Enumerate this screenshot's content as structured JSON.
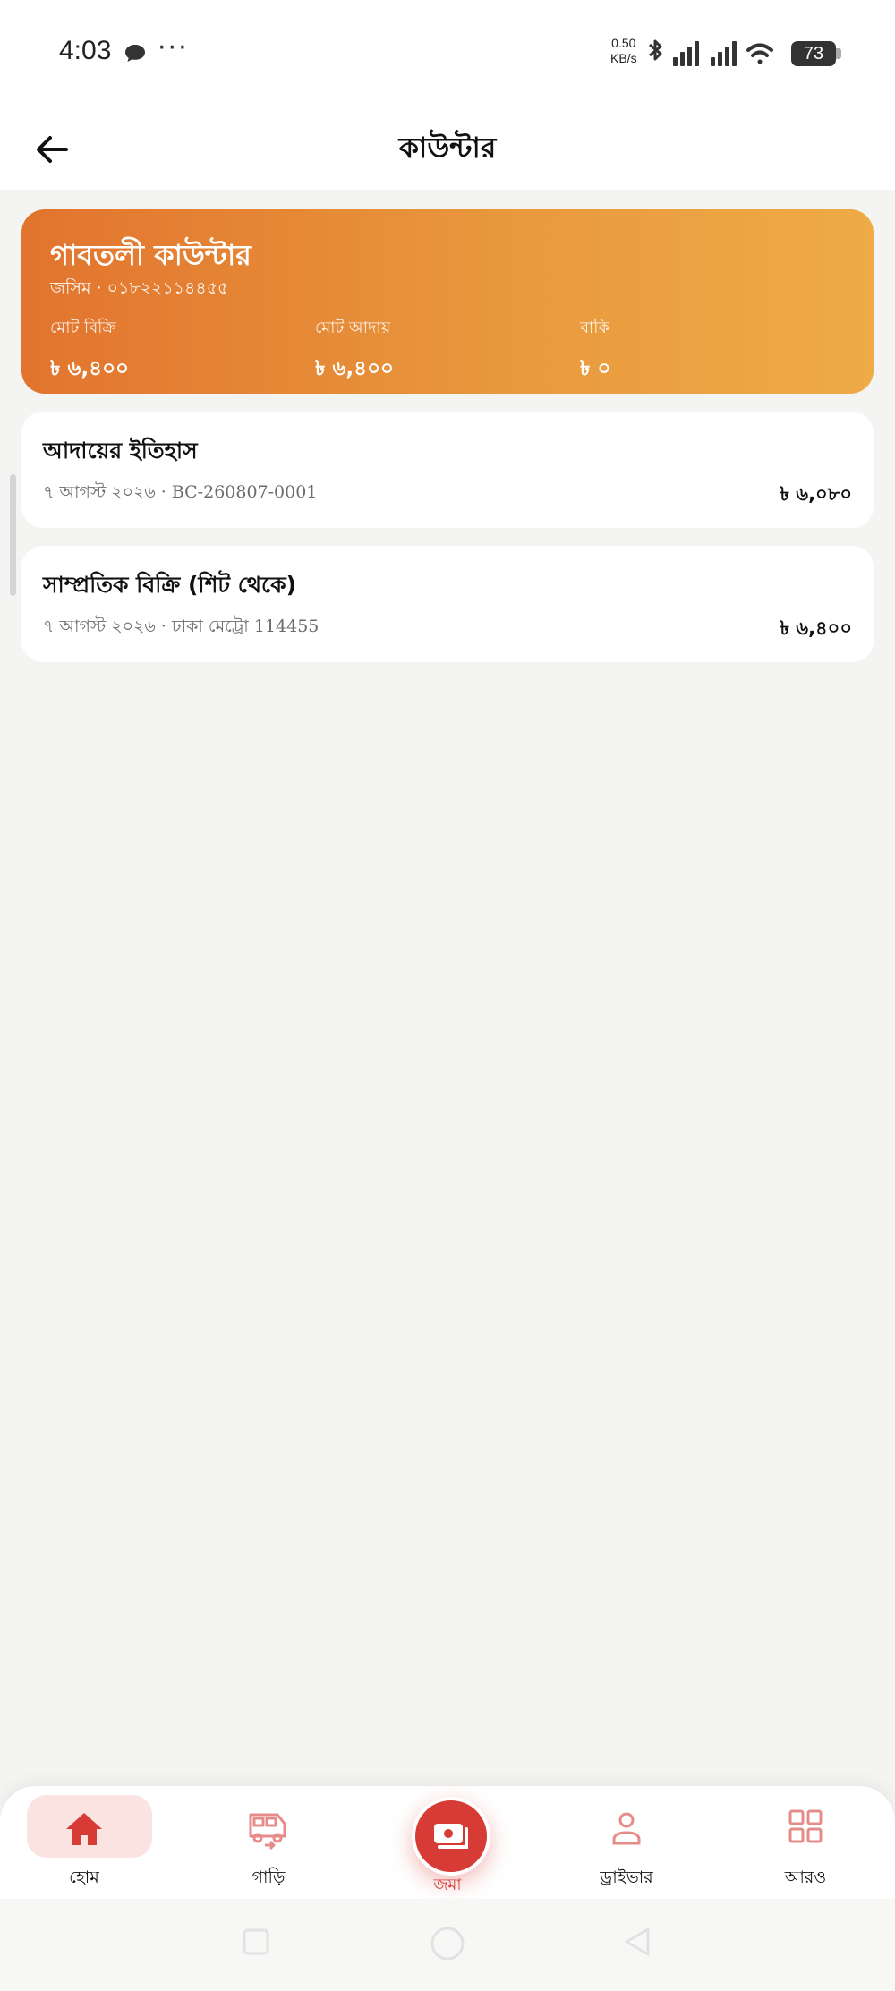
{
  "status_bar": {
    "time": "4:03",
    "speed_value": "0.50",
    "speed_unit": "KB/s",
    "battery": "73",
    "icons": [
      "chat-bubble-icon",
      "more-dots-icon",
      "bluetooth-icon",
      "signal-icon",
      "signal-icon",
      "wifi-icon",
      "battery-icon"
    ]
  },
  "header": {
    "title": "কাউন্টার",
    "back_icon": "arrow-left-icon"
  },
  "summary": {
    "counter_name": "গাবতলী কাউন্টার",
    "subtitle": "জসিম · ০১৮২২১১৪৪৫৫",
    "stats": [
      {
        "label": "মোট বিক্রি",
        "value": "৳ ৬,৪০০"
      },
      {
        "label": "মোট আদায়",
        "value": "৳ ৬,৪০০"
      },
      {
        "label": "বাকি",
        "value": "৳ ০"
      }
    ],
    "gradient_start": "#e2742e",
    "gradient_end": "#eeab46"
  },
  "cards": [
    {
      "title": "আদায়ের ইতিহাস",
      "subtitle": "৭ আগস্ট ২০২৬ · BC-260807-0001",
      "amount": "৳ ৬,০৮০"
    },
    {
      "title": "সাম্প্রতিক বিক্রি (শিট থেকে)",
      "subtitle": "৭ আগস্ট ২০২৬ · ঢাকা মেট্রো 114455",
      "amount": "৳ ৬,৪০০"
    }
  ],
  "bottom_nav": {
    "items": [
      {
        "label": "হোম",
        "icon": "home-icon"
      },
      {
        "label": "গাড়ি",
        "icon": "bus-icon"
      },
      {
        "label": "জমা",
        "icon": "cash-icon"
      },
      {
        "label": "ড্রাইভার",
        "icon": "person-icon"
      },
      {
        "label": "আরও",
        "icon": "grid-icon"
      }
    ],
    "accent_color": "#d73b35",
    "active_bg": "#fbe3e1"
  }
}
